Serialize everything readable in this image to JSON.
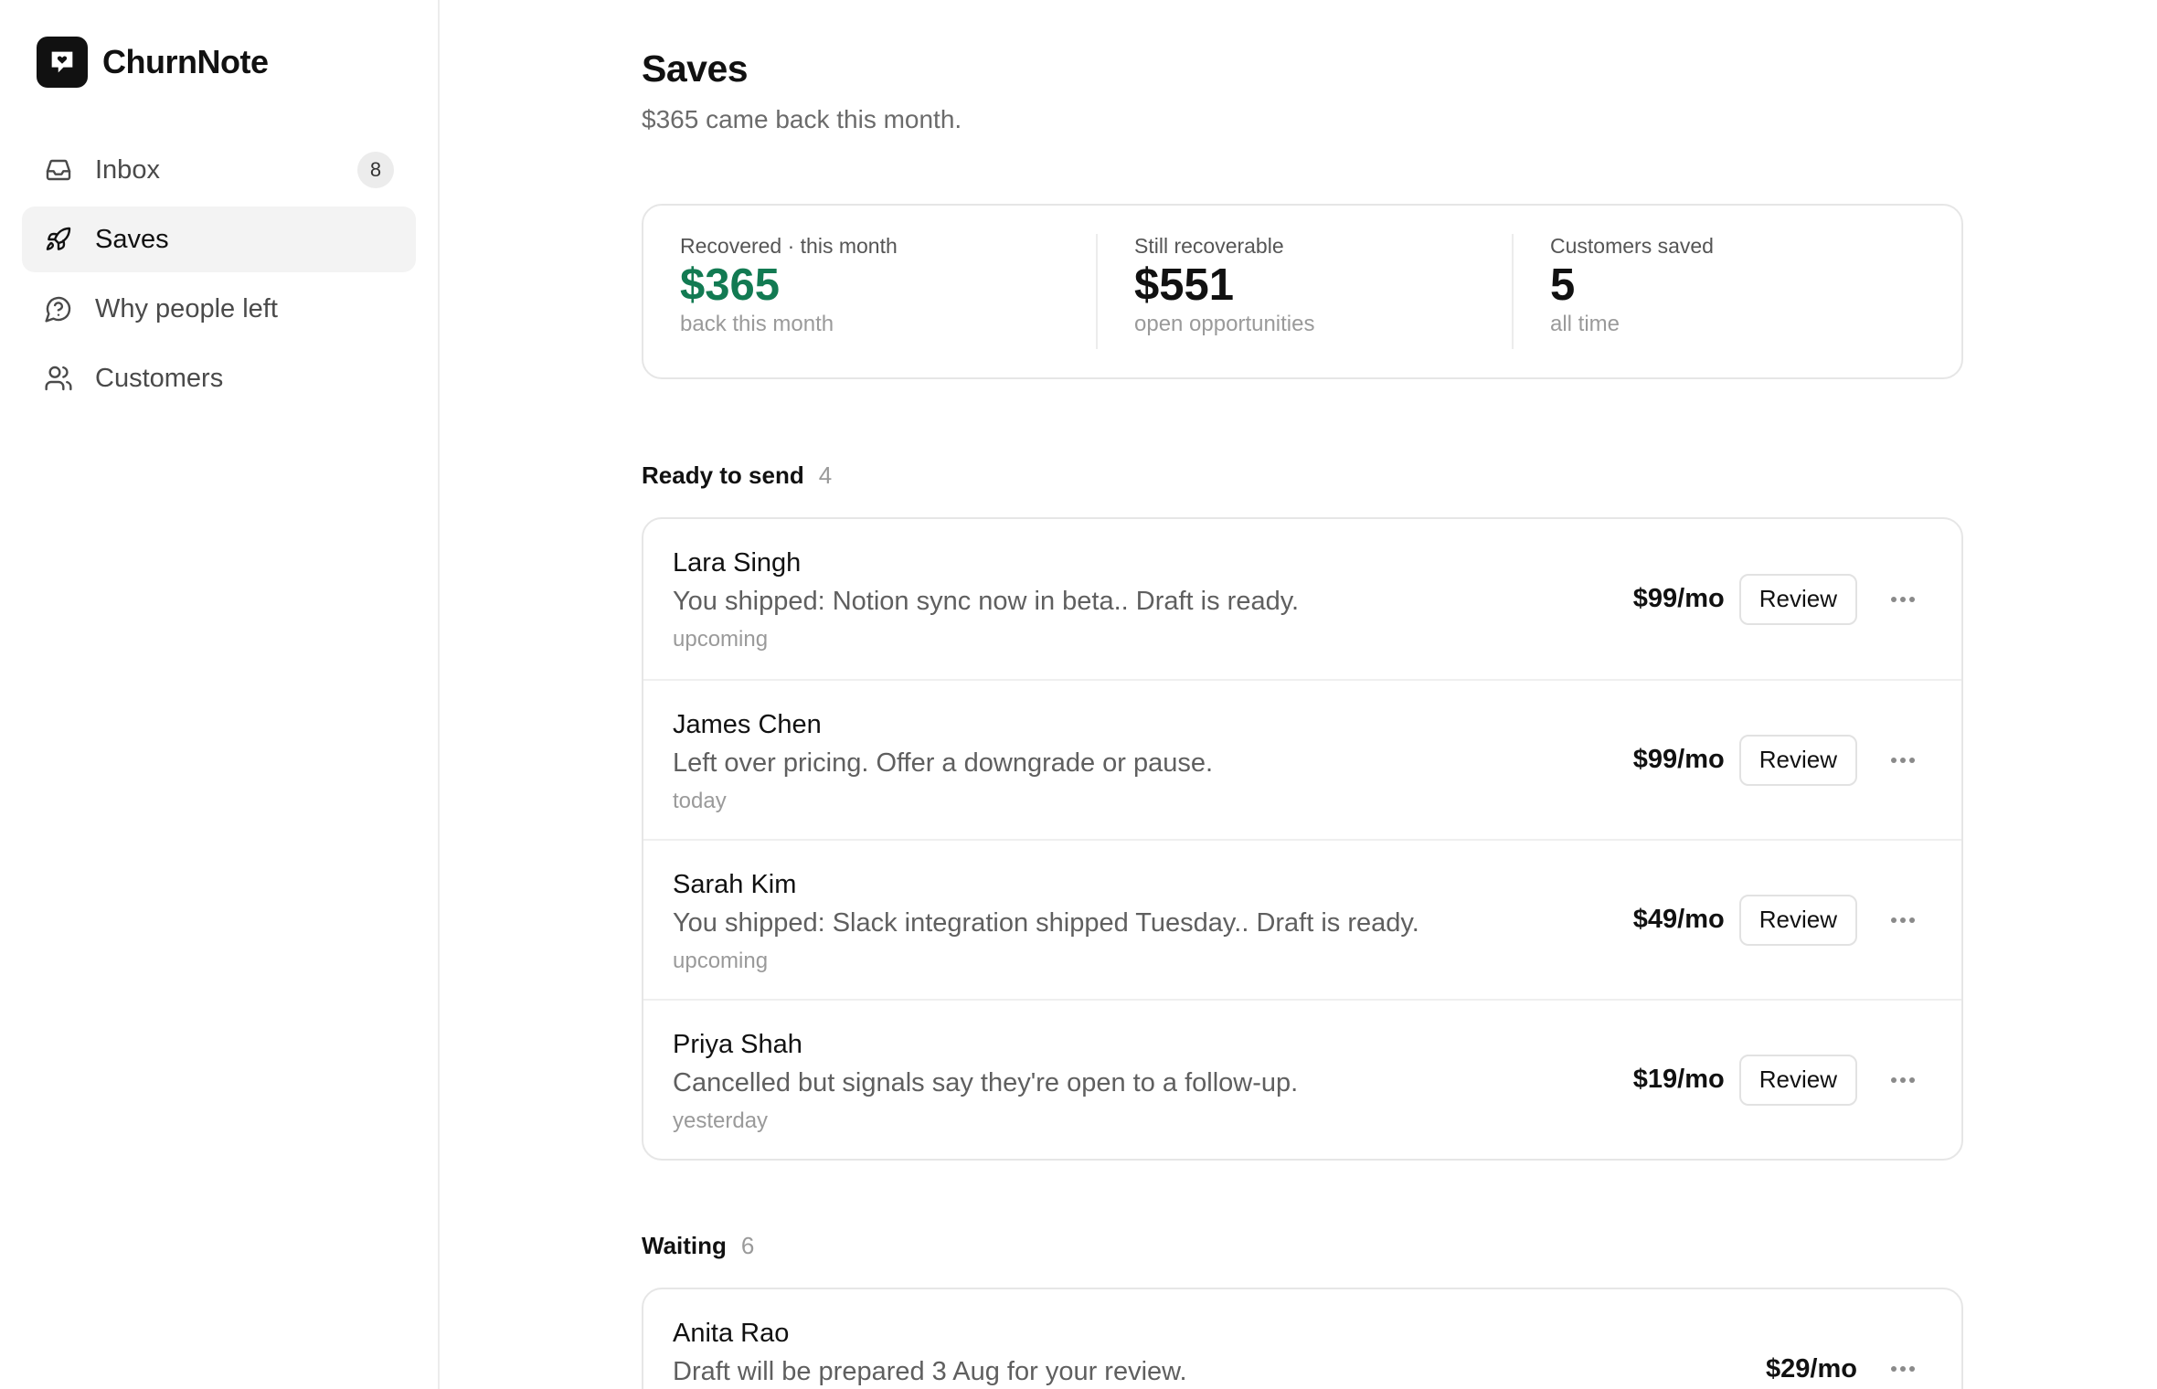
{
  "brand": {
    "name": "ChurnNote",
    "logo_icon": "heart-message-icon"
  },
  "sidebar": {
    "items": [
      {
        "label": "Inbox",
        "icon": "inbox-icon",
        "badge": "8",
        "active": false
      },
      {
        "label": "Saves",
        "icon": "rocket-icon",
        "active": true
      },
      {
        "label": "Why people left",
        "icon": "question-bubble-icon",
        "active": false
      },
      {
        "label": "Customers",
        "icon": "users-icon",
        "active": false
      }
    ]
  },
  "page": {
    "title": "Saves",
    "subtitle": "$365 came back this month."
  },
  "stats": [
    {
      "label": "Recovered · this month",
      "value": "$365",
      "sub": "back this month",
      "color": "#127a52"
    },
    {
      "label": "Still recoverable",
      "value": "$551",
      "sub": "open opportunities"
    },
    {
      "label": "Customers saved",
      "value": "5",
      "sub": "all time"
    }
  ],
  "sections": {
    "ready": {
      "title": "Ready to send",
      "count": "4",
      "rows": [
        {
          "name": "Lara Singh",
          "desc": "You shipped: Notion sync now in beta.. Draft is ready.",
          "time": "upcoming",
          "price": "$99/mo",
          "action": "Review"
        },
        {
          "name": "James Chen",
          "desc": "Left over pricing. Offer a downgrade or pause.",
          "time": "today",
          "price": "$99/mo",
          "action": "Review"
        },
        {
          "name": "Sarah Kim",
          "desc": "You shipped: Slack integration shipped Tuesday.. Draft is ready.",
          "time": "upcoming",
          "price": "$49/mo",
          "action": "Review"
        },
        {
          "name": "Priya Shah",
          "desc": "Cancelled but signals say they're open to a follow-up.",
          "time": "yesterday",
          "price": "$19/mo",
          "action": "Review"
        }
      ]
    },
    "waiting": {
      "title": "Waiting",
      "count": "6",
      "rows": [
        {
          "name": "Anita Rao",
          "desc": "Draft will be prepared 3 Aug for your review.",
          "price": "$29/mo"
        }
      ]
    }
  },
  "colors": {
    "accent_green": "#127a52",
    "active_bg": "#f3f3f3"
  }
}
